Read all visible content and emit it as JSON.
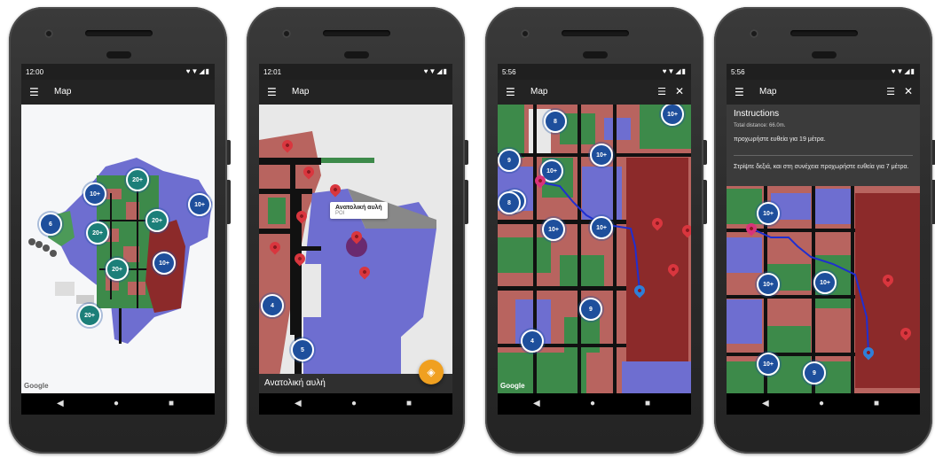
{
  "phones": [
    {
      "status_time": "12:00",
      "status_icons": "♥▼◢▮",
      "appbar_title": "Map",
      "google_logo": "Google",
      "clusters": [
        "10+",
        "20+",
        "10+",
        "6",
        "20+",
        "20+",
        "20+",
        "10+",
        "20+"
      ]
    },
    {
      "status_time": "12:01",
      "status_icons": "♥▼◢▮",
      "appbar_title": "Map",
      "poi_title": "Ανατολική αυλή",
      "poi_subtitle": "POI",
      "clusters": [
        "4",
        "5"
      ],
      "bottom_label": "Ανατολική αυλή"
    },
    {
      "status_time": "5:56",
      "status_icons": "♥▼◢▮",
      "appbar_title": "Map",
      "google_logo": "Google",
      "clusters": [
        "8",
        "10+",
        "10+",
        "9",
        "10+",
        "10+",
        "8",
        "10+",
        "10+",
        "9",
        "4"
      ]
    },
    {
      "status_time": "5:56",
      "status_icons": "♥▼◢▮",
      "appbar_title": "Map",
      "instructions_title": "Instructions",
      "total_distance": "Total distance: 66.0m.",
      "instruction_prev": "προχωρήστε ευθεία για 19 μέτρα.",
      "instruction_next": "Στρίψτε δεξιά, και στη συνέχεια προχωρήστε ευθεία για 7 μέτρα.",
      "clusters": [
        "10+",
        "10+",
        "10+",
        "10+",
        "9"
      ]
    }
  ],
  "colors": {
    "cluster_blue": "#1e4f9c",
    "poi_red": "#d9363e",
    "route_blue": "#1f2fd0",
    "fab_orange": "#f0a020"
  }
}
